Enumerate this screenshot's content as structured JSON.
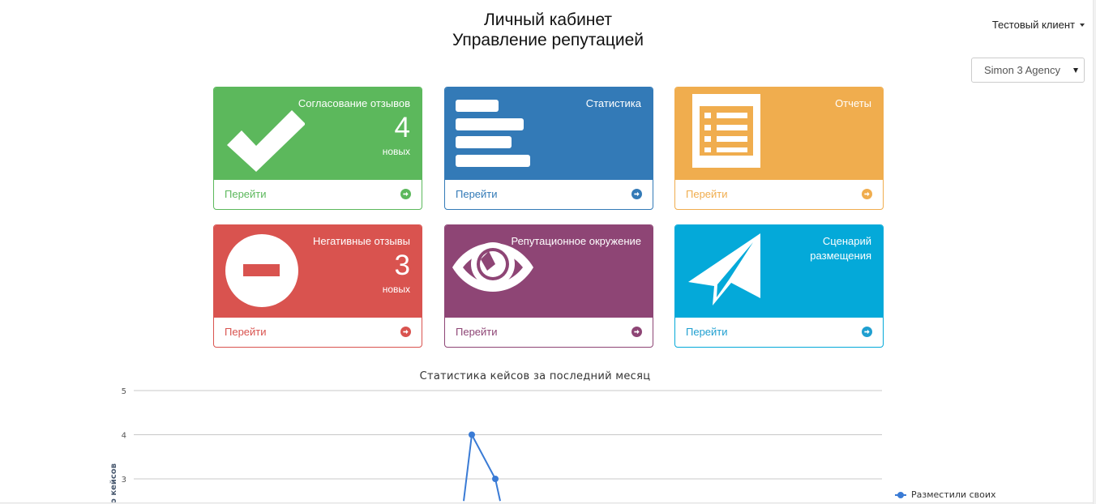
{
  "header": {
    "title_line1": "Личный кабинет",
    "title_line2": "Управление репутацией",
    "user_menu": "Тестовый клиент",
    "agency_select": {
      "value": "Simon 3 Agency"
    }
  },
  "tiles": [
    {
      "id": "reviews-approval",
      "title": "Согласование отзывов",
      "count": "4",
      "unit": "новых",
      "link": "Перейти",
      "icon": "checkmark-icon",
      "color": "#5cb85c"
    },
    {
      "id": "statistics",
      "title": "Статистика",
      "link": "Перейти",
      "icon": "bar-list-icon",
      "color": "#337ab7"
    },
    {
      "id": "reports",
      "title": "Отчеты",
      "link": "Перейти",
      "icon": "report-list-icon",
      "color": "#f0ad4e"
    },
    {
      "id": "negative-reviews",
      "title": "Негативные отзывы",
      "count": "3",
      "unit": "новых",
      "link": "Перейти",
      "icon": "minus-circle-icon",
      "color": "#d9534f"
    },
    {
      "id": "reputation-environment",
      "title": "Репутационное окружение",
      "link": "Перейти",
      "icon": "eye-icon",
      "color": "#8e4575"
    },
    {
      "id": "placement-scenario",
      "title_line1": "Сценарий",
      "title_line2": "размещения",
      "link": "Перейти",
      "icon": "paper-plane-icon",
      "color": "#04a9d9"
    }
  ],
  "chart_data": {
    "type": "line",
    "title": "Статистика кейсов за последний месяц",
    "ylabel": "Количество кейсов",
    "ylabel_visible": "о кейсов",
    "y_ticks": [
      5,
      4,
      3
    ],
    "ylim_visible": [
      2.5,
      5
    ],
    "grid": true,
    "legend_position": "right",
    "series": [
      {
        "name": "Разместили своих",
        "color": "#3a7bd5",
        "points_visible": [
          {
            "x_index": 0,
            "y": 2.5,
            "marker": false
          },
          {
            "x_index": 1,
            "y": 4,
            "marker": true
          },
          {
            "x_index": 2,
            "y": 3,
            "marker": true
          },
          {
            "x_index": 3,
            "y": 2.5,
            "marker": false
          }
        ]
      }
    ]
  }
}
